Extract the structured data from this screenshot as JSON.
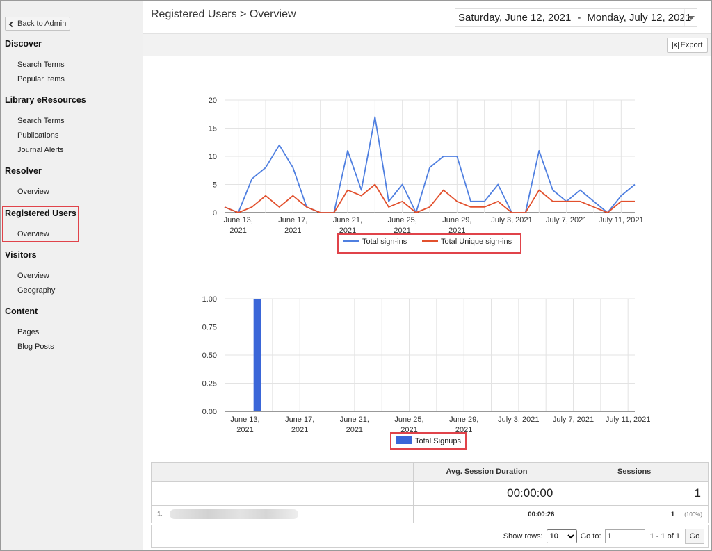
{
  "sidebar": {
    "back_label": "Back to Admin",
    "sections": [
      {
        "title": "Discover",
        "items": [
          "Search Terms",
          "Popular Items"
        ]
      },
      {
        "title": "Library eResources",
        "items": [
          "Search Terms",
          "Publications",
          "Journal Alerts"
        ]
      },
      {
        "title": "Resolver",
        "items": [
          "Overview"
        ]
      },
      {
        "title": "Registered Users",
        "items": [
          "Overview"
        ]
      },
      {
        "title": "Visitors",
        "items": [
          "Overview",
          "Geography"
        ]
      },
      {
        "title": "Content",
        "items": [
          "Pages",
          "Blog Posts"
        ]
      }
    ]
  },
  "header": {
    "title": "Registered Users > Overview",
    "date_start": "Saturday, June 12, 2021",
    "date_sep": "-",
    "date_end": "Monday, July 12, 2021"
  },
  "toolbar": {
    "export_label": "Export"
  },
  "colors": {
    "accent_blue": "#4f7fe0",
    "accent_red": "#e2502d",
    "bar_blue": "#3a66d8",
    "highlight_red": "#e0434a"
  },
  "chart_data": [
    {
      "type": "line",
      "x": [
        "June 12, 2021",
        "June 13, 2021",
        "June 14, 2021",
        "June 15, 2021",
        "June 16, 2021",
        "June 17, 2021",
        "June 18, 2021",
        "June 19, 2021",
        "June 20, 2021",
        "June 21, 2021",
        "June 22, 2021",
        "June 23, 2021",
        "June 24, 2021",
        "June 25, 2021",
        "June 26, 2021",
        "June 27, 2021",
        "June 28, 2021",
        "June 29, 2021",
        "June 30, 2021",
        "July 1, 2021",
        "July 2, 2021",
        "July 3, 2021",
        "July 4, 2021",
        "July 5, 2021",
        "July 6, 2021",
        "July 7, 2021",
        "July 8, 2021",
        "July 9, 2021",
        "July 10, 2021",
        "July 11, 2021",
        "July 12, 2021"
      ],
      "tick_labels": [
        [
          "June 13,",
          "2021"
        ],
        [
          "June 17,",
          "2021"
        ],
        [
          "June 21,",
          "2021"
        ],
        [
          "June 25,",
          "2021"
        ],
        [
          "June 29,",
          "2021"
        ],
        [
          "July 3, 2021",
          ""
        ],
        [
          "July 7, 2021",
          ""
        ],
        [
          "July 11, 2021",
          ""
        ]
      ],
      "y_ticks": [
        "0",
        "5",
        "10",
        "15",
        "20"
      ],
      "ylim": [
        0,
        20
      ],
      "series": [
        {
          "name": "Total sign-ins",
          "color": "#4f7fe0",
          "values": [
            1,
            0,
            6,
            8,
            12,
            8,
            1,
            0,
            0,
            11,
            4,
            17,
            2,
            5,
            0,
            8,
            10,
            10,
            2,
            2,
            5,
            0,
            0,
            11,
            4,
            2,
            4,
            2,
            0,
            3,
            5
          ]
        },
        {
          "name": "Total Unique sign-ins",
          "color": "#e2502d",
          "values": [
            1,
            0,
            1,
            3,
            1,
            3,
            1,
            0,
            0,
            4,
            3,
            5,
            1,
            2,
            0,
            1,
            4,
            2,
            1,
            1,
            2,
            0,
            0,
            4,
            2,
            2,
            2,
            1,
            0,
            2,
            2
          ]
        }
      ],
      "legend": "bottom"
    },
    {
      "type": "bar",
      "x": [
        "June 12, 2021",
        "June 13, 2021",
        "June 14, 2021",
        "June 15, 2021",
        "June 16, 2021",
        "June 17, 2021",
        "June 18, 2021",
        "June 19, 2021",
        "June 20, 2021",
        "June 21, 2021",
        "June 22, 2021",
        "June 23, 2021",
        "June 24, 2021",
        "June 25, 2021",
        "June 26, 2021",
        "June 27, 2021",
        "June 28, 2021",
        "June 29, 2021",
        "June 30, 2021",
        "July 1, 2021",
        "July 2, 2021",
        "July 3, 2021",
        "July 4, 2021",
        "July 5, 2021",
        "July 6, 2021",
        "July 7, 2021",
        "July 8, 2021",
        "July 9, 2021",
        "July 10, 2021",
        "July 11, 2021",
        "July 12, 2021"
      ],
      "tick_labels": [
        [
          "June 13,",
          "2021"
        ],
        [
          "June 17,",
          "2021"
        ],
        [
          "June 21,",
          "2021"
        ],
        [
          "June 25,",
          "2021"
        ],
        [
          "June 29,",
          "2021"
        ],
        [
          "July 3, 2021",
          ""
        ],
        [
          "July 7, 2021",
          ""
        ],
        [
          "July 11, 2021",
          ""
        ]
      ],
      "y_ticks": [
        "0.00",
        "0.25",
        "0.50",
        "0.75",
        "1.00"
      ],
      "ylim": [
        0,
        1
      ],
      "series": [
        {
          "name": "Total Signups",
          "color": "#3a66d8",
          "values": [
            0,
            0,
            1,
            0,
            0,
            0,
            0,
            0,
            0,
            0,
            0,
            0,
            0,
            0,
            0,
            0,
            0,
            0,
            0,
            0,
            0,
            0,
            0,
            0,
            0,
            0,
            0,
            0,
            0,
            0,
            0
          ]
        }
      ],
      "legend": "bottom"
    }
  ],
  "table": {
    "headers": [
      "",
      "Avg. Session Duration",
      "Sessions"
    ],
    "totals": [
      "",
      "00:00:00",
      "1"
    ],
    "rows": [
      {
        "index": "1.",
        "duration": "00:00:26",
        "sessions": "1",
        "percent": "(100%)"
      }
    ]
  },
  "pager": {
    "show_rows_label": "Show rows:",
    "rows_value": "10",
    "goto_label": "Go to:",
    "goto_value": "1",
    "range_text": "1 - 1 of 1",
    "go_label": "Go"
  }
}
